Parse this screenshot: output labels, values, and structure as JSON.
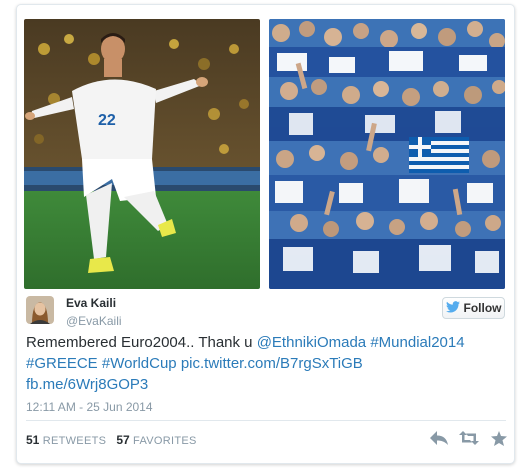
{
  "tweet": {
    "author_name": "Eva Kaili",
    "author_handle": "@EvaKaili",
    "follow_label": "Follow",
    "text_plain": "Remembered Euro2004.. Thank u ",
    "links": [
      "@EthnikiOmada",
      "#Mundial2014",
      "#GREECE",
      "#WorldCup",
      "pic.twitter.com/B7rgSxTiGB",
      "fb.me/6Wrj8GOP3"
    ],
    "timestamp": "12:11 AM - 25 Jun 2014",
    "retweets_count": "51",
    "retweets_label": "RETWEETS",
    "favorites_count": "57",
    "favorites_label": "FAVORITES",
    "jersey_number": "22"
  },
  "colors": {
    "link": "#2b7bb9",
    "text": "#292f33",
    "muted": "#8899a6",
    "twitter_bird": "#55acee"
  },
  "icons": {
    "follow": "twitter-bird-icon",
    "reply": "reply-icon",
    "retweet": "retweet-icon",
    "favorite": "star-icon"
  }
}
